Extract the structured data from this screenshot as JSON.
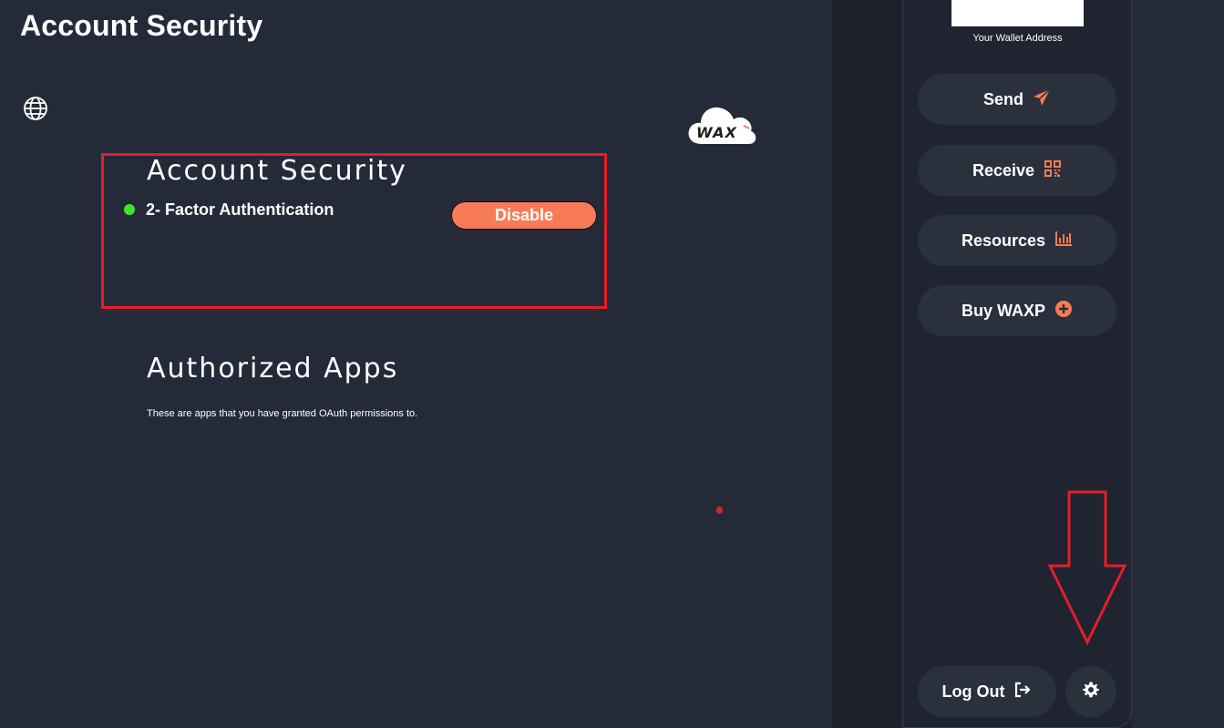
{
  "header": {
    "title": "Account Security"
  },
  "logo": {
    "text": "WAX"
  },
  "security": {
    "title": "Account Security",
    "tfa_label": "2- Factor Authentication",
    "tfa_status_color": "#3ee62a",
    "disable_label": "Disable"
  },
  "apps": {
    "title": "Authorized Apps",
    "description": "These are apps that you have granted OAuth permissions to."
  },
  "sidebar": {
    "wallet_label": "Your Wallet Address",
    "buttons": [
      {
        "label": "Send",
        "icon": "paper-plane-icon"
      },
      {
        "label": "Receive",
        "icon": "qr-code-icon"
      },
      {
        "label": "Resources",
        "icon": "bar-chart-icon"
      },
      {
        "label": "Buy WAXP",
        "icon": "plus-circle-icon"
      }
    ],
    "logout_label": "Log Out",
    "settings_icon": "gear-icon"
  },
  "colors": {
    "accent": "#f77b54",
    "background": "#252a38",
    "annotation": "#e41e26"
  }
}
